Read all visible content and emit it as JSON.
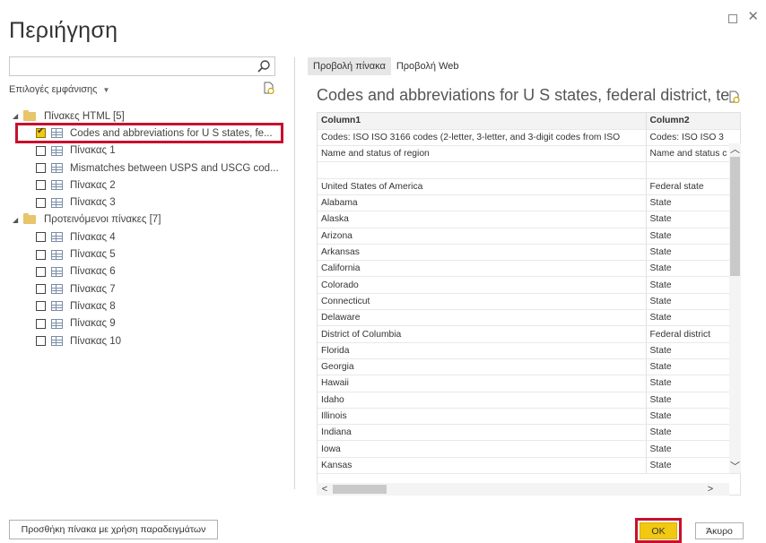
{
  "dialog": {
    "title": "Περιήγηση"
  },
  "search": {
    "value": "",
    "placeholder": ""
  },
  "display_options": {
    "label": "Επιλογές εμφάνισης"
  },
  "tree": {
    "groups": [
      {
        "label": "Πίνακες HTML [5]",
        "items": [
          {
            "label": "Codes and abbreviations for U S states, fe...",
            "checked": true
          },
          {
            "label": "Πίνακας 1",
            "checked": false
          },
          {
            "label": "Mismatches between USPS and USCG cod...",
            "checked": false
          },
          {
            "label": "Πίνακας 2",
            "checked": false
          },
          {
            "label": "Πίνακας 3",
            "checked": false
          }
        ]
      },
      {
        "label": "Προτεινόμενοι πίνακες [7]",
        "items": [
          {
            "label": "Πίνακας 4",
            "checked": false
          },
          {
            "label": "Πίνακας 5",
            "checked": false
          },
          {
            "label": "Πίνακας 6",
            "checked": false
          },
          {
            "label": "Πίνακας 7",
            "checked": false
          },
          {
            "label": "Πίνακας 8",
            "checked": false
          },
          {
            "label": "Πίνακας 9",
            "checked": false
          },
          {
            "label": "Πίνακας 10",
            "checked": false
          }
        ]
      }
    ]
  },
  "tabs": [
    {
      "label": "Προβολή πίνακα",
      "active": true
    },
    {
      "label": "Προβολή Web",
      "active": false
    }
  ],
  "preview": {
    "title": "Codes and abbreviations for U S states, federal district, terr...",
    "columns": [
      "Column1",
      "Column2"
    ],
    "rows": [
      [
        "Codes:   ISO ISO 3166 codes (2-letter, 3-letter, and 3-digit codes from ISO",
        "Codes:   ISO ISO 3"
      ],
      [
        "Name and status of region",
        "Name and status c"
      ],
      [
        "",
        ""
      ],
      [
        "United States of America",
        "Federal state"
      ],
      [
        "Alabama",
        "State"
      ],
      [
        "Alaska",
        "State"
      ],
      [
        "Arizona",
        "State"
      ],
      [
        "Arkansas",
        "State"
      ],
      [
        "California",
        "State"
      ],
      [
        "Colorado",
        "State"
      ],
      [
        "Connecticut",
        "State"
      ],
      [
        "Delaware",
        "State"
      ],
      [
        "District of Columbia",
        "Federal district"
      ],
      [
        "Florida",
        "State"
      ],
      [
        "Georgia",
        "State"
      ],
      [
        "Hawaii",
        "State"
      ],
      [
        "Idaho",
        "State"
      ],
      [
        "Illinois",
        "State"
      ],
      [
        "Indiana",
        "State"
      ],
      [
        "Iowa",
        "State"
      ],
      [
        "Kansas",
        "State"
      ]
    ]
  },
  "buttons": {
    "add_table_label": "Προσθήκη πίνακα με χρήση παραδειγμάτων",
    "ok_label": "OK",
    "cancel_label": "Άκυρο"
  },
  "colors": {
    "accent": "#f2c811",
    "highlight": "#c8102e"
  }
}
